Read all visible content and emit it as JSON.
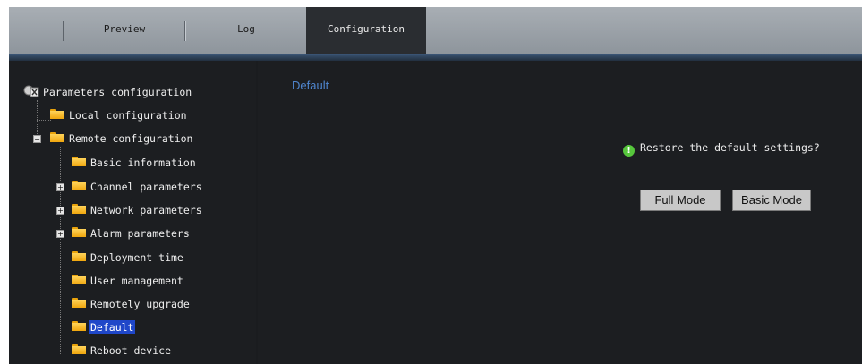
{
  "tabs": [
    {
      "label": "Preview"
    },
    {
      "label": "Log"
    },
    {
      "label": "Configuration",
      "active": true
    }
  ],
  "tree": {
    "root": "Parameters configuration",
    "items": [
      {
        "label": "Local configuration"
      },
      {
        "label": "Remote configuration",
        "expanded": true
      },
      {
        "label": "Basic information"
      },
      {
        "label": "Channel parameters",
        "collapsed": true
      },
      {
        "label": "Network parameters",
        "collapsed": true
      },
      {
        "label": "Alarm parameters",
        "collapsed": true
      },
      {
        "label": "Deployment time"
      },
      {
        "label": "User management"
      },
      {
        "label": "Remotely upgrade"
      },
      {
        "label": "Default",
        "selected": true
      },
      {
        "label": "Reboot device"
      }
    ]
  },
  "main": {
    "section_title": "Default",
    "prompt": "Restore the default settings?",
    "full_mode_label": "Full Mode",
    "basic_mode_label": "Basic Mode"
  },
  "icons": {
    "root": "tools-icon",
    "folder": "folder-icon",
    "expander": "plus-minus-icon",
    "prompt": "info-icon"
  },
  "colors": {
    "tab_bar": "#9aa1a8",
    "active_tab": "#2a2d31",
    "panel": "#1c1e21",
    "selected": "#1f47c9",
    "title_blue": "#4f86cf",
    "info_green": "#56c63c"
  }
}
